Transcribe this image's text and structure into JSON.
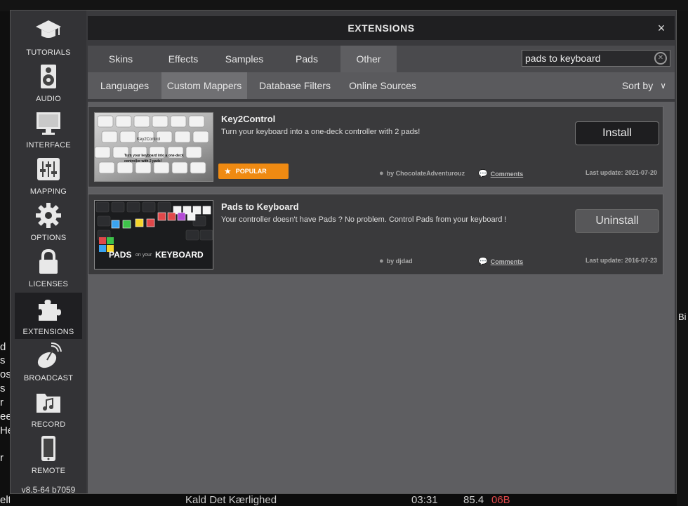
{
  "modal": {
    "title": "EXTENSIONS",
    "close_glyph": "×",
    "version": "v8.5-64 b7059"
  },
  "sidebar": {
    "items": [
      {
        "label": "TUTORIALS",
        "icon": "graduation-cap-icon"
      },
      {
        "label": "AUDIO",
        "icon": "speaker-icon"
      },
      {
        "label": "INTERFACE",
        "icon": "monitor-icon"
      },
      {
        "label": "MAPPING",
        "icon": "sliders-icon"
      },
      {
        "label": "OPTIONS",
        "icon": "gear-icon"
      },
      {
        "label": "LICENSES",
        "icon": "lock-icon"
      },
      {
        "label": "EXTENSIONS",
        "icon": "puzzle-icon",
        "active": true
      },
      {
        "label": "BROADCAST",
        "icon": "satellite-dish-icon"
      },
      {
        "label": "RECORD",
        "icon": "music-folder-icon"
      },
      {
        "label": "REMOTE",
        "icon": "phone-icon"
      }
    ]
  },
  "tabs": [
    {
      "label": "Skins"
    },
    {
      "label": "Effects"
    },
    {
      "label": "Samples"
    },
    {
      "label": "Pads"
    },
    {
      "label": "Other",
      "active": true
    }
  ],
  "search": {
    "value": "pads to keyboard",
    "clear_glyph": "✕"
  },
  "subtabs": [
    {
      "label": "Languages"
    },
    {
      "label": "Custom Mappers",
      "active": true
    },
    {
      "label": "Database Filters"
    },
    {
      "label": "Online Sources"
    }
  ],
  "sort": {
    "label": "Sort by",
    "chevron": "∨"
  },
  "extensions": [
    {
      "name": "Key2Control",
      "description": "Turn your keyboard into a one-deck controller with 2 pads!",
      "author": "by ChocolateAdventurouz",
      "comments": "Comments",
      "last_update": "Last update: 2021-07-20",
      "badge": "POPULAR",
      "action": "Install",
      "thumb_text": "Key2Control",
      "thumb_caption": "Turn your keyboard into a one-deck controller with 2 pads!"
    },
    {
      "name": "Pads to Keyboard",
      "description": "Your controller doesn't have Pads ? No problem. Control Pads from your keyboard !",
      "author": "by djdad",
      "comments": "Comments",
      "last_update": "Last update: 2016-07-23",
      "action": "Uninstall",
      "thumb_pads": "PADS",
      "thumb_on": "on your",
      "thumb_keyboard": "KEYBOARD"
    }
  ],
  "background": {
    "left_fragments": [
      "d",
      "s",
      "os",
      "s",
      "r",
      "ee",
      "He",
      "r",
      "elt"
    ],
    "right_fragment": "Bi",
    "bottom_title": "Kald Det Kærlighed",
    "bottom_time": "03:31",
    "bottom_bpm": "85.4",
    "bottom_key": "06B"
  },
  "colors": {
    "accent_orange": "#ef8a12",
    "key_red": "#e0484a"
  }
}
